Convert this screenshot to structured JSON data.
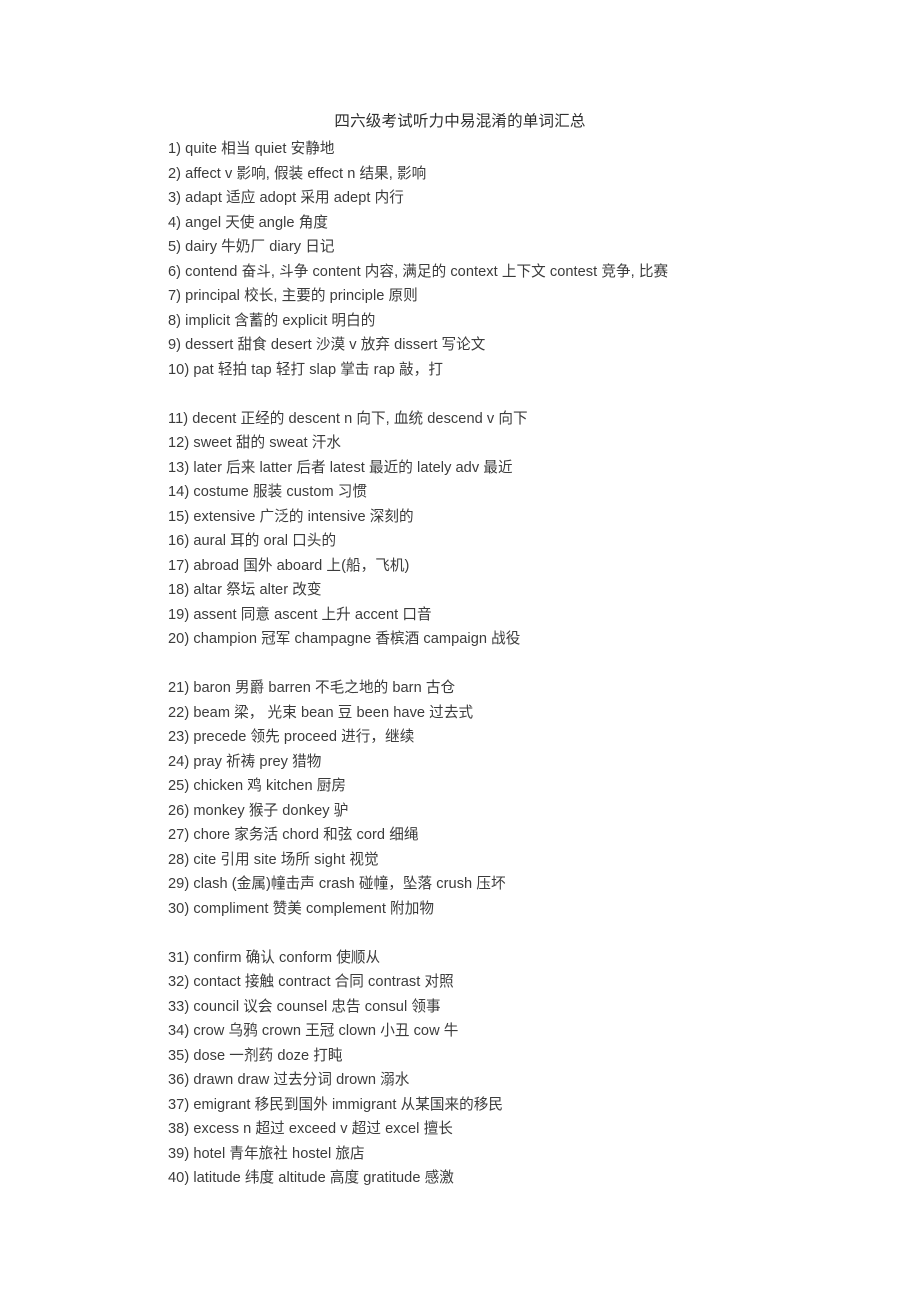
{
  "document": {
    "title": "四六级考试听力中易混淆的单词汇总",
    "entries": [
      {
        "text": "1) quite  相当  quiet  安静地",
        "group_start": false
      },
      {
        "text": "2) affect v  影响, 假装  effect n  结果, 影响",
        "group_start": false
      },
      {
        "text": "3) adapt  适应  adopt  采用  adept  内行",
        "group_start": false
      },
      {
        "text": "4) angel  天使  angle  角度",
        "group_start": false
      },
      {
        "text": "5) dairy  牛奶厂  diary  日记",
        "group_start": false
      },
      {
        "text": "6) contend  奋斗, 斗争  content  内容, 满足的  context  上下文  contest  竞争, 比赛",
        "group_start": false
      },
      {
        "text": "7) principal  校长, 主要的  principle  原则",
        "group_start": false
      },
      {
        "text": "8) implicit  含蓄的  explicit  明白的",
        "group_start": false
      },
      {
        "text": "9) dessert  甜食  desert  沙漠 v  放弃  dissert  写论文",
        "group_start": false
      },
      {
        "text": "10) pat  轻拍  tap  轻打  slap  掌击  rap  敲，打",
        "group_start": false
      },
      {
        "text": "11) decent  正经的  descent n  向下, 血统  descend v  向下",
        "group_start": true
      },
      {
        "text": "12) sweet  甜的  sweat  汗水",
        "group_start": false
      },
      {
        "text": "13) later  后来  latter  后者  latest  最近的  lately adv  最近",
        "group_start": false
      },
      {
        "text": "14) costume  服装  custom  习惯",
        "group_start": false
      },
      {
        "text": "15) extensive  广泛的  intensive  深刻的",
        "group_start": false
      },
      {
        "text": "16) aural  耳的  oral  口头的",
        "group_start": false
      },
      {
        "text": "17) abroad  国外  aboard  上(船，飞机)",
        "group_start": false
      },
      {
        "text": "18) altar  祭坛  alter  改变",
        "group_start": false
      },
      {
        "text": "19) assent  同意  ascent  上升  accent  口音",
        "group_start": false
      },
      {
        "text": "20) champion  冠军  champagne  香槟酒  campaign  战役",
        "group_start": false
      },
      {
        "text": "21) baron  男爵  barren  不毛之地的  barn  古仓",
        "group_start": true
      },
      {
        "text": "22) beam  梁，  光束  bean  豆  been have  过去式",
        "group_start": false
      },
      {
        "text": "23) precede  领先  proceed  进行，继续",
        "group_start": false
      },
      {
        "text": "24) pray  祈祷  prey  猎物",
        "group_start": false
      },
      {
        "text": "25) chicken  鸡  kitchen  厨房",
        "group_start": false
      },
      {
        "text": "26) monkey  猴子  donkey  驴",
        "group_start": false
      },
      {
        "text": "27) chore  家务活  chord  和弦  cord  细绳",
        "group_start": false
      },
      {
        "text": "28) cite  引用  site  场所  sight  视觉",
        "group_start": false
      },
      {
        "text": "29) clash (金属)幢击声  crash  碰幢，坠落  crush  压坏",
        "group_start": false
      },
      {
        "text": "30) compliment  赞美  complement  附加物",
        "group_start": false
      },
      {
        "text": "31) confirm  确认  conform  使顺从",
        "group_start": true
      },
      {
        "text": "32) contact  接触  contract  合同  contrast  对照",
        "group_start": false
      },
      {
        "text": "33) council  议会  counsel  忠告  consul  领事",
        "group_start": false
      },
      {
        "text": "34) crow  乌鸦  crown  王冠  clown  小丑  cow  牛",
        "group_start": false
      },
      {
        "text": "35) dose  一剂药  doze  打盹",
        "group_start": false
      },
      {
        "text": "36) drawn draw  过去分词  drown  溺水",
        "group_start": false
      },
      {
        "text": "37) emigrant  移民到国外  immigrant  从某国来的移民",
        "group_start": false
      },
      {
        "text": "38) excess n  超过  exceed v 超过  excel  擅长",
        "group_start": false
      },
      {
        "text": "39) hotel  青年旅社  hostel  旅店",
        "group_start": false
      },
      {
        "text": "40) latitude  纬度  altitude  高度  gratitude  感激",
        "group_start": false
      }
    ]
  }
}
